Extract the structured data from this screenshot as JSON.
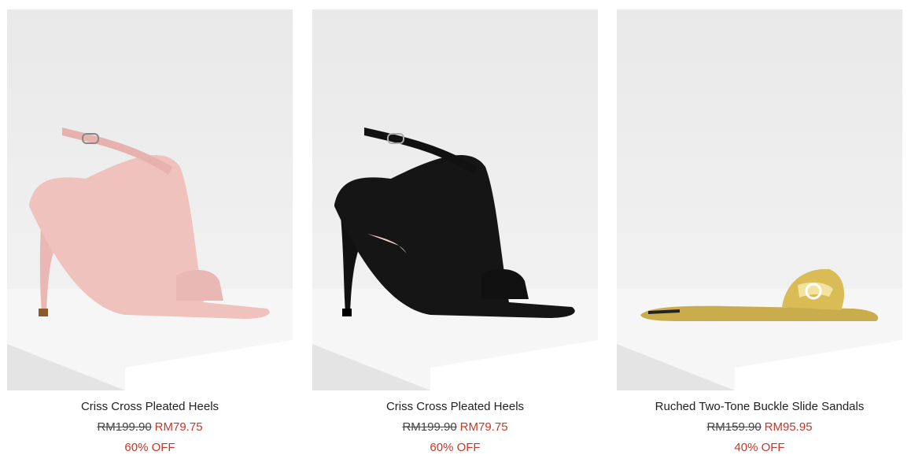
{
  "products": [
    {
      "name": "Criss Cross Pleated Heels",
      "original_price": "RM199.90",
      "sale_price": "RM79.75",
      "discount": "60% OFF",
      "color": "#e9b8b4"
    },
    {
      "name": "Criss Cross Pleated Heels",
      "original_price": "RM199.90",
      "sale_price": "RM79.75",
      "discount": "60% OFF",
      "color": "#111111"
    },
    {
      "name": "Ruched Two-Tone Buckle Slide Sandals",
      "original_price": "RM159.90",
      "sale_price": "RM95.95",
      "discount": "40% OFF",
      "color": "#c9ad4c"
    }
  ],
  "sale_color": "#c0392b"
}
